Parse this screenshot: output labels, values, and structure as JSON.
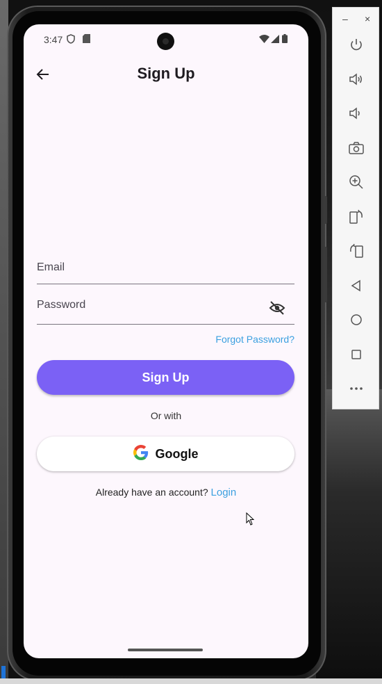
{
  "status_bar": {
    "time": "3:47"
  },
  "app_bar": {
    "title": "Sign Up"
  },
  "form": {
    "email_label": "Email",
    "password_label": "Password",
    "forgot_password": "Forgot Password?",
    "submit_label": "Sign Up",
    "or_with": "Or with",
    "google_label": "Google",
    "account_prompt": "Already have an account?",
    "login_link": "Login"
  },
  "emulator_toolbar": {
    "minimize": "–",
    "close": "×",
    "buttons": [
      "power",
      "volume-up",
      "volume-down",
      "camera",
      "zoom",
      "rotate-left",
      "rotate-right",
      "back",
      "home",
      "overview",
      "more"
    ]
  },
  "colors": {
    "accent": "#7b61f5",
    "link": "#3ba0e0",
    "screen_bg": "#fdf7fd"
  }
}
